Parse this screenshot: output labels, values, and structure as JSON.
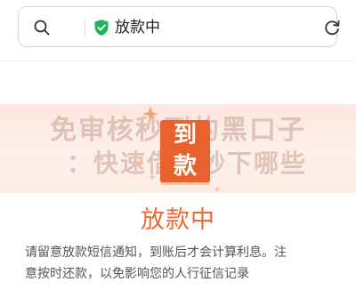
{
  "address_bar": {
    "url_text": "放款中",
    "secure_icon": "shield-check-icon",
    "search_icon": "search-icon",
    "reload_icon": "reload-icon"
  },
  "banner": {
    "faint_line1": "免审核秒到的黑口子",
    "faint_line2": "：快速借钱秒下哪些",
    "sticker_top": "到",
    "sticker_bottom": "款"
  },
  "status": {
    "title": "放款中",
    "notice_line1": "请留意放款短信通知，到账后才会计算利息。注",
    "notice_line2": "意按时还款，以免影响您的人行征信记录"
  },
  "colors": {
    "accent": "#ec6a38",
    "sticker": "#e9612c",
    "shield": "#22b35a",
    "banner_bg": "#fbe7df"
  }
}
